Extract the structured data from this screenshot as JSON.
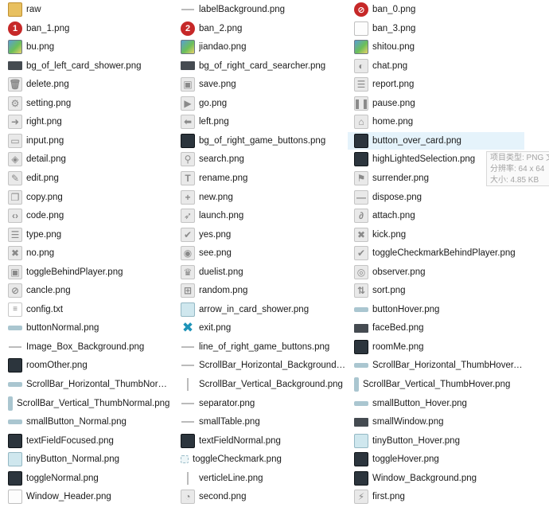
{
  "files": [
    {
      "name": "raw",
      "icon": "folder-icon"
    },
    {
      "name": "labelBackground.png",
      "icon": "line-icon"
    },
    {
      "name": "ban_0.png",
      "icon": "red-badge-icon",
      "glyph": "⊘"
    },
    {
      "name": "ban_1.png",
      "icon": "red-badge-icon",
      "glyph": "1"
    },
    {
      "name": "ban_2.png",
      "icon": "red-badge-icon",
      "glyph": "2"
    },
    {
      "name": "ban_3.png",
      "icon": "blank-file-icon"
    },
    {
      "name": "bu.png",
      "icon": "picture-icon"
    },
    {
      "name": "jiandao.png",
      "icon": "picture-icon"
    },
    {
      "name": "shitou.png",
      "icon": "picture-icon"
    },
    {
      "name": "bg_of_left_card_shower.png",
      "icon": "dark-bar-icon"
    },
    {
      "name": "bg_of_right_card_searcher.png",
      "icon": "dark-bar-icon"
    },
    {
      "name": "chat.png",
      "icon": "chat-icon",
      "glyph": "◐"
    },
    {
      "name": "delete.png",
      "icon": "trash-icon",
      "glyph": "🗑"
    },
    {
      "name": "save.png",
      "icon": "save-icon",
      "glyph": "▣"
    },
    {
      "name": "report.png",
      "icon": "report-icon",
      "glyph": "☰"
    },
    {
      "name": "setting.png",
      "icon": "gear-icon",
      "glyph": "⚙"
    },
    {
      "name": "go.png",
      "icon": "play-icon",
      "glyph": "▶"
    },
    {
      "name": "pause.png",
      "icon": "pause-icon",
      "glyph": "❚❚"
    },
    {
      "name": "right.png",
      "icon": "arrow-right-icon",
      "glyph": "➜"
    },
    {
      "name": "left.png",
      "icon": "arrow-left-icon",
      "glyph": "⬅"
    },
    {
      "name": "home.png",
      "icon": "home-icon",
      "glyph": "⌂"
    },
    {
      "name": "input.png",
      "icon": "input-icon",
      "glyph": "▭"
    },
    {
      "name": "bg_of_right_game_buttons.png",
      "icon": "dark-square-icon"
    },
    {
      "name": "button_over_card.png",
      "icon": "dark-square-icon"
    },
    {
      "name": "detail.png",
      "icon": "detail-icon",
      "glyph": "◈"
    },
    {
      "name": "search.png",
      "icon": "search-icon",
      "glyph": "⚲"
    },
    {
      "name": "highLightedSelection.png",
      "icon": "dark-square-icon"
    },
    {
      "name": "edit.png",
      "icon": "pencil-icon",
      "glyph": "✎"
    },
    {
      "name": "rename.png",
      "icon": "rename-icon",
      "glyph": "T"
    },
    {
      "name": "surrender.png",
      "icon": "flag-icon",
      "glyph": "⚑"
    },
    {
      "name": "copy.png",
      "icon": "copy-icon",
      "glyph": "❐"
    },
    {
      "name": "new.png",
      "icon": "plus-icon",
      "glyph": "+"
    },
    {
      "name": "dispose.png",
      "icon": "minus-icon",
      "glyph": "—"
    },
    {
      "name": "code.png",
      "icon": "code-icon",
      "glyph": "‹›"
    },
    {
      "name": "launch.png",
      "icon": "launch-icon",
      "glyph": "➶"
    },
    {
      "name": "attach.png",
      "icon": "paperclip-icon",
      "glyph": "∂"
    },
    {
      "name": "type.png",
      "icon": "list-icon",
      "glyph": "☰"
    },
    {
      "name": "yes.png",
      "icon": "checkmark-icon",
      "glyph": "✔"
    },
    {
      "name": "kick.png",
      "icon": "cross-icon",
      "glyph": "✖"
    },
    {
      "name": "no.png",
      "icon": "cross-icon",
      "glyph": "✖"
    },
    {
      "name": "see.png",
      "icon": "eye-icon",
      "glyph": "◉"
    },
    {
      "name": "toggleCheckmarkBehindPlayer.png",
      "icon": "checkmark-icon",
      "glyph": "✔"
    },
    {
      "name": "toggleBehindPlayer.png",
      "icon": "toggle-icon",
      "glyph": "▣"
    },
    {
      "name": "duelist.png",
      "icon": "trophy-icon",
      "glyph": "♛"
    },
    {
      "name": "observer.png",
      "icon": "observer-icon",
      "glyph": "◎"
    },
    {
      "name": "cancle.png",
      "icon": "cancel-icon",
      "glyph": "⊘"
    },
    {
      "name": "random.png",
      "icon": "random-icon",
      "glyph": "⊞"
    },
    {
      "name": "sort.png",
      "icon": "sort-icon",
      "glyph": "⇅"
    },
    {
      "name": "config.txt",
      "icon": "text-file-icon",
      "glyph": "≡"
    },
    {
      "name": "arrow_in_card_shower.png",
      "icon": "light-square-icon"
    },
    {
      "name": "buttonHover.png",
      "icon": "light-bar-icon"
    },
    {
      "name": "buttonNormal.png",
      "icon": "light-bar-icon"
    },
    {
      "name": "exit.png",
      "icon": "exit-x-icon",
      "glyph": "✖"
    },
    {
      "name": "faceBed.png",
      "icon": "dark-bar-icon"
    },
    {
      "name": "Image_Box_Background.png",
      "icon": "line-icon"
    },
    {
      "name": "line_of_right_game_buttons.png",
      "icon": "line-icon"
    },
    {
      "name": "roomMe.png",
      "icon": "dark-square-icon"
    },
    {
      "name": "roomOther.png",
      "icon": "dark-square-icon"
    },
    {
      "name": "ScrollBar_Horizontal_Background.png",
      "icon": "line-icon"
    },
    {
      "name": "ScrollBar_Horizontal_ThumbHover.png",
      "icon": "light-bar-icon"
    },
    {
      "name": "ScrollBar_Horizontal_ThumbNormal.png",
      "icon": "light-bar-icon"
    },
    {
      "name": "ScrollBar_Vertical_Background.png",
      "icon": "vertical-line-icon"
    },
    {
      "name": "ScrollBar_Vertical_ThumbHover.png",
      "icon": "vertical-bar-icon"
    },
    {
      "name": "ScrollBar_Vertical_ThumbNormal.png",
      "icon": "vertical-bar-icon"
    },
    {
      "name": "separator.png",
      "icon": "line-icon"
    },
    {
      "name": "smallButton_Hover.png",
      "icon": "light-bar-icon"
    },
    {
      "name": "smallButton_Normal.png",
      "icon": "light-bar-icon"
    },
    {
      "name": "smallTable.png",
      "icon": "line-icon"
    },
    {
      "name": "smallWindow.png",
      "icon": "dark-bar-icon"
    },
    {
      "name": "textFieldFocused.png",
      "icon": "dark-square-icon"
    },
    {
      "name": "textFieldNormal.png",
      "icon": "dark-square-icon"
    },
    {
      "name": "tinyButton_Hover.png",
      "icon": "light-square-icon"
    },
    {
      "name": "tinyButton_Normal.png",
      "icon": "light-square-icon"
    },
    {
      "name": "toggleCheckmark.png",
      "icon": "small-square-icon"
    },
    {
      "name": "toggleHover.png",
      "icon": "dark-square-icon"
    },
    {
      "name": "toggleNormal.png",
      "icon": "dark-square-icon"
    },
    {
      "name": "verticleLine.png",
      "icon": "vertical-line-icon"
    },
    {
      "name": "Window_Background.png",
      "icon": "dark-square-icon"
    },
    {
      "name": "Window_Header.png",
      "icon": "blank-file-icon"
    },
    {
      "name": "second.png",
      "icon": "clock-icon",
      "glyph": "◔"
    },
    {
      "name": "first.png",
      "icon": "first-icon",
      "glyph": "⚡"
    }
  ],
  "selected_index": 23,
  "tooltip": {
    "line1": "项目类型: PNG 文件",
    "line2": "分辨率: 64 x 64",
    "line3": "大小: 4.85 KB"
  }
}
